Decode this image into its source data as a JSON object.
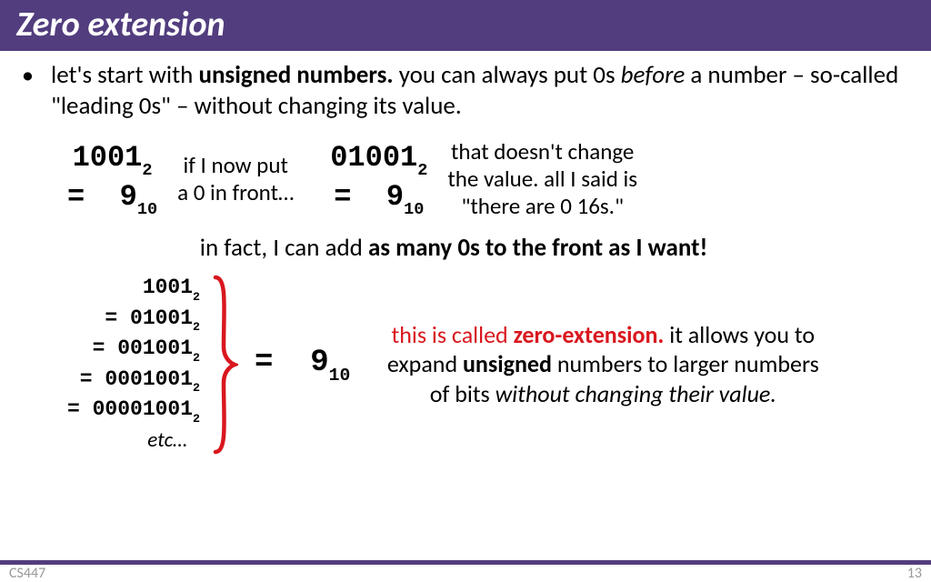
{
  "title": "Zero extension",
  "bullet": {
    "pre": "let's start with ",
    "bold1": "unsigned numbers.",
    "mid1": " you can always put 0s ",
    "ital1": "before",
    "mid2": " a number – so-called \"leading 0s\" – without changing its value."
  },
  "eq1": {
    "bin": "1001",
    "binSub": "2",
    "eq": "= ",
    "dec": "9",
    "decSub": "10"
  },
  "note1": {
    "l1": "if I now put",
    "l2": "a 0 in front…"
  },
  "eq2": {
    "bin": "01001",
    "binSub": "2",
    "eq": "= ",
    "dec": "9",
    "decSub": "10"
  },
  "note2": {
    "l1": "that doesn't change",
    "l2": "the value. all I said is",
    "l3": "\"there are 0 16s.\""
  },
  "centerLine": {
    "pre": "in fact, I can add ",
    "bold": "as many 0s to the front as I want!"
  },
  "stack": {
    "r1": {
      "v": "1001",
      "s": "2"
    },
    "r2": {
      "p": "= ",
      "v": "01001",
      "s": "2"
    },
    "r3": {
      "p": "= ",
      "v": "001001",
      "s": "2"
    },
    "r4": {
      "p": "= ",
      "v": "0001001",
      "s": "2"
    },
    "r5": {
      "p": "= ",
      "v": "00001001",
      "s": "2"
    },
    "etc": "etc…"
  },
  "result": {
    "eq": "= ",
    "dec": "9",
    "decSub": "10"
  },
  "explain": {
    "pre": "this is called ",
    "bold1": "zero-extension.",
    "mid1": " it allows you to expand ",
    "bold2": "unsigned",
    "mid2": " numbers to larger numbers of bits ",
    "ital": "without changing their value."
  },
  "footer": {
    "left": "CS447",
    "right": "13"
  }
}
